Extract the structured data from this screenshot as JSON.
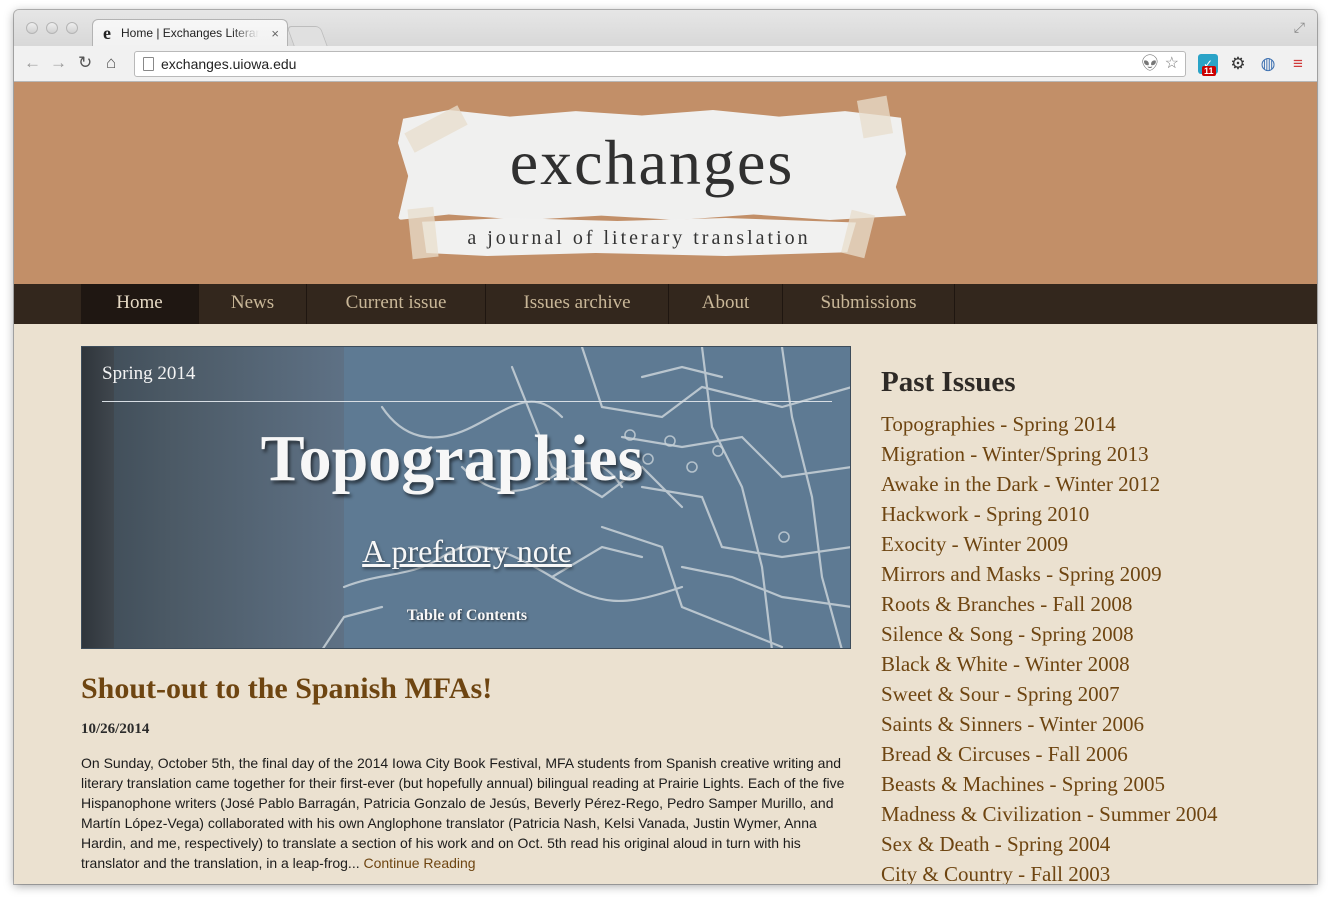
{
  "browser": {
    "tab_title": "Home | Exchanges Literary",
    "tab_close": "×",
    "url": "exchanges.uiowa.edu",
    "favicon_glyph": "e",
    "extension_badge": "11"
  },
  "masthead": {
    "title": "exchanges",
    "subtitle": "a journal of literary translation"
  },
  "nav": {
    "items": [
      {
        "label": "Home",
        "active": true
      },
      {
        "label": "News"
      },
      {
        "label": "Current issue"
      },
      {
        "label": "Issues archive"
      },
      {
        "label": "About"
      },
      {
        "label": "Submissions"
      }
    ]
  },
  "hero": {
    "season": "Spring 2014",
    "title": "Topographies",
    "note_link": "A prefatory note",
    "toc_link": "Table of Contents"
  },
  "post": {
    "title": "Shout-out to the Spanish MFAs!",
    "date": "10/26/2014",
    "body": "On Sunday, October 5th, the final day of the 2014 Iowa City Book Festival, MFA students from Spanish creative writing and literary translation came together for their first-ever (but hopefully annual) bilingual reading at Prairie Lights. Each of the five Hispanophone writers (José Pablo Barragán, Patricia Gonzalo de Jesús, Beverly Pérez-Rego, Pedro Samper Murillo, and Martín López-Vega) collaborated with his own Anglophone translator (Patricia Nash, Kelsi Vanada, Justin Wymer, Anna Hardin, and me, respectively) to translate a section of his work and on Oct. 5th read his original aloud in turn with his translator and the translation, in a leap-frog...",
    "continue_link": "Continue Reading"
  },
  "sidebar": {
    "heading": "Past Issues",
    "issues": [
      "Topographies - Spring 2014",
      "Migration - Winter/Spring 2013",
      "Awake in the Dark - Winter 2012",
      "Hackwork - Spring 2010",
      "Exocity - Winter 2009",
      "Mirrors and Masks - Spring 2009",
      "Roots & Branches - Fall 2008",
      "Silence & Song - Spring 2008",
      "Black & White - Winter 2008",
      "Sweet & Sour - Spring 2007",
      "Saints & Sinners - Winter 2006",
      "Bread & Circuses - Fall 2006",
      "Beasts & Machines - Spring 2005",
      "Madness & Civilization - Summer 2004",
      "Sex & Death - Spring 2004",
      "City & Country - Fall 2003"
    ]
  },
  "colors": {
    "masthead": "#c28f68",
    "navbar": "#33271d",
    "link_brown": "#6e4511",
    "page_bg": "#ebe1d0"
  }
}
